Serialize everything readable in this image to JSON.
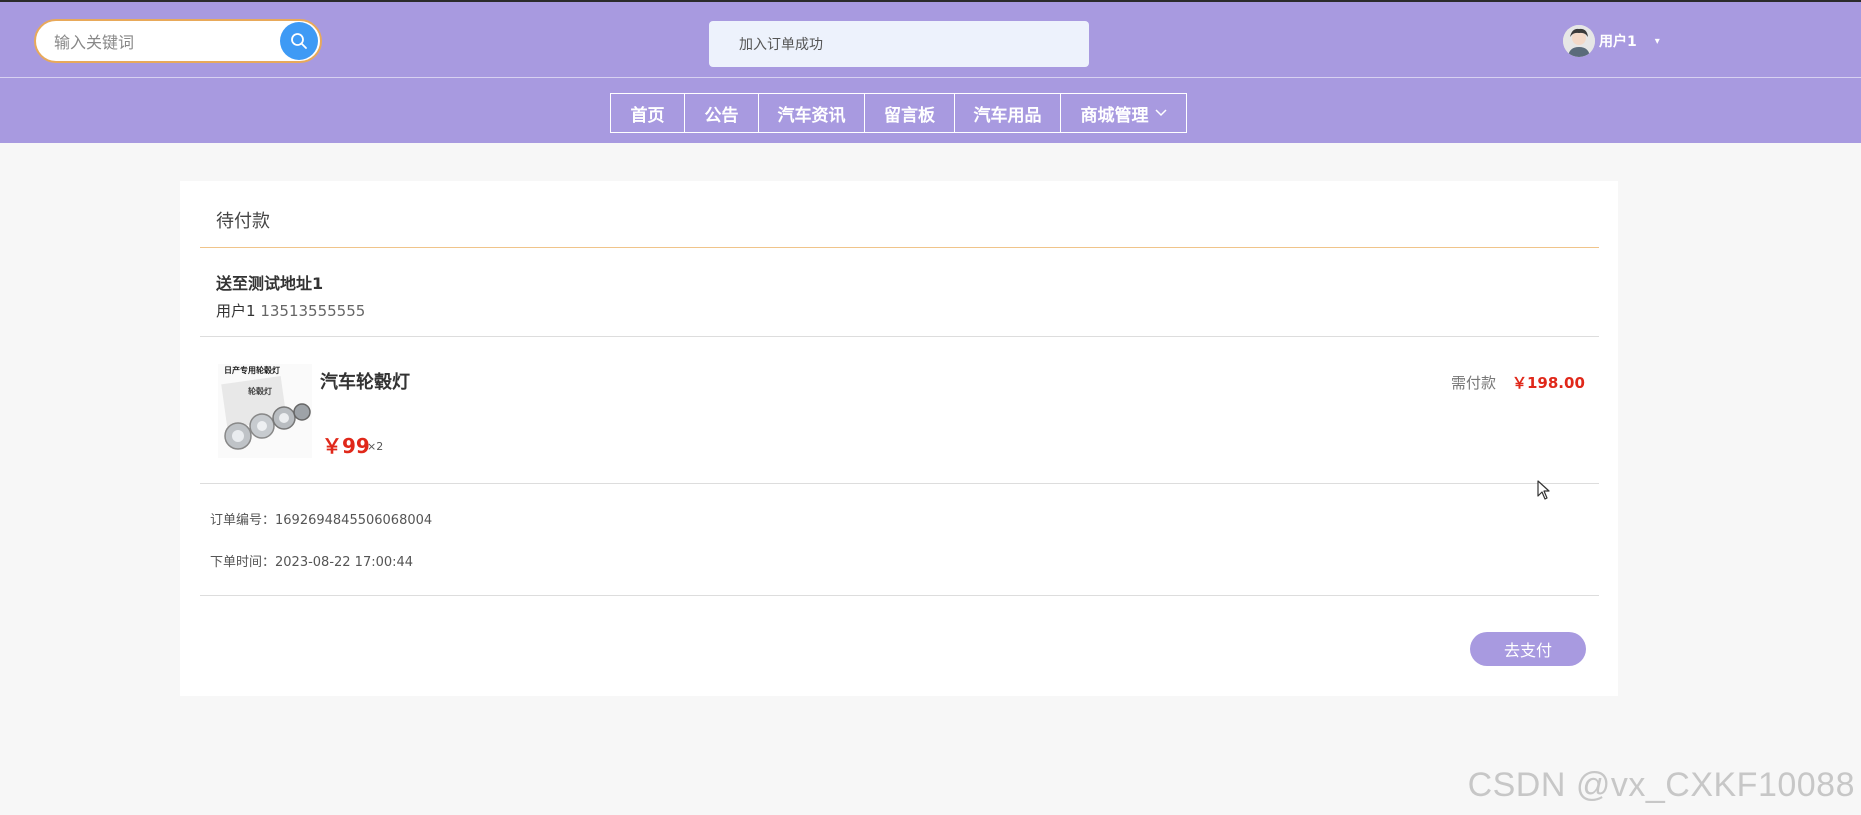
{
  "header": {
    "search": {
      "placeholder": "输入关键词",
      "value": ""
    },
    "toast": "加入订单成功",
    "user": {
      "name": "用户1"
    }
  },
  "nav": {
    "items": [
      {
        "label": "首页"
      },
      {
        "label": "公告"
      },
      {
        "label": "汽车资讯"
      },
      {
        "label": "留言板"
      },
      {
        "label": "汽车用品"
      },
      {
        "label": "商城管理"
      }
    ]
  },
  "order": {
    "status": "待付款",
    "address": {
      "title": "送至测试地址1",
      "name": "用户1",
      "phone": "13513555555"
    },
    "product": {
      "name": "汽车轮毂灯",
      "price": "￥99",
      "quantity": "×2",
      "image_label": "日产专用轮毂灯",
      "image_sub": "轮毂灯"
    },
    "payable": {
      "label": "需付款",
      "total": "￥198.00"
    },
    "order_no": "订单编号：1692694845506068004",
    "order_time": "下单时间：2023-08-22 17:00:44",
    "pay_button": "去支付"
  },
  "watermark": "CSDN @vx_CXKF10088",
  "colors": {
    "header": "#a89ae0",
    "accent_orange": "#e8a95a",
    "search_button": "#3e9af5",
    "price_red": "#e0281a"
  }
}
